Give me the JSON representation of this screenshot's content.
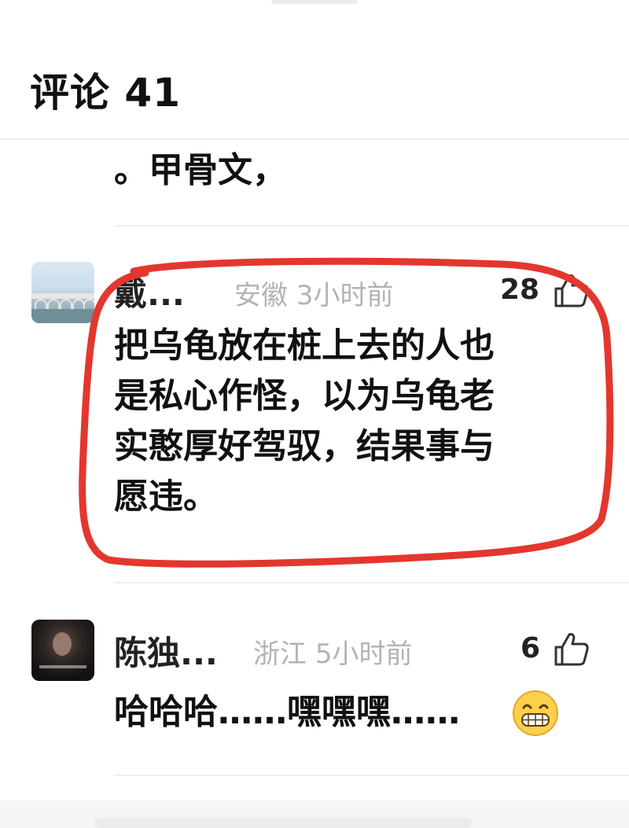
{
  "header": {
    "title": "评论 41"
  },
  "previous_comment": {
    "text_tail": "。甲骨文，"
  },
  "comments": [
    {
      "user_name": "戴...",
      "location": "安徽",
      "time": "3小时前",
      "likes": "28",
      "body": "把乌龟放在桩上去的人也是私心作怪，以为乌龟老实憨厚好驾驭，结果事与愿违。",
      "body_lines": [
        "把乌龟放在桩上去的人也",
        "是私心作怪，以为乌龟老",
        "实憨厚好驾驭，结果事与",
        "愿违。"
      ],
      "highlight": "red-hand-drawn-circle"
    },
    {
      "user_name": "陈独...",
      "location": "浙江",
      "time": "5小时前",
      "likes": "6",
      "body": "哈哈哈……嘿嘿嘿……",
      "emoji": "grinning-face-emoji"
    }
  ],
  "icons": {
    "like": "thumbs-up-icon"
  },
  "colors": {
    "annotation_red": "#e3372e",
    "meta_gray": "#b3b3b3",
    "text_dark": "#111111"
  }
}
